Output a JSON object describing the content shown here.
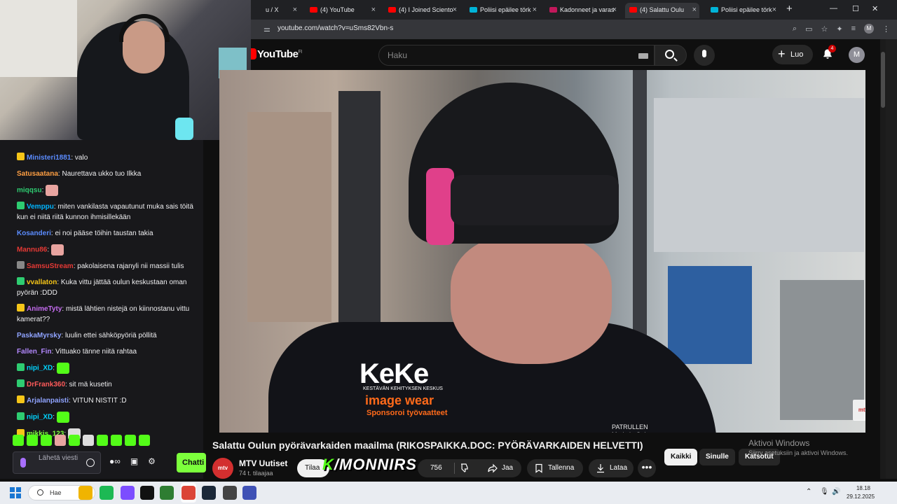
{
  "browser": {
    "tabs": [
      {
        "label": "u / X",
        "fav": "#202124",
        "active": false
      },
      {
        "label": "(4) YouTube",
        "fav": "#ff0000",
        "active": false
      },
      {
        "label": "(4) I Joined Sciento",
        "fav": "#ff0000",
        "active": false
      },
      {
        "label": "Poliisi epäilee törk",
        "fav": "#00b4d8",
        "active": false
      },
      {
        "label": "Kadonneet ja varas",
        "fav": "#c2185b",
        "active": false
      },
      {
        "label": "(4) Salattu Oulu",
        "fav": "#ff0000",
        "active": true
      },
      {
        "label": "Poliisi epäilee törk",
        "fav": "#00b4d8",
        "active": false
      }
    ],
    "new_tab": "+",
    "url": "youtube.com/watch?v=uSms82Vbn-s",
    "profile_initial": "M",
    "window_controls": {
      "minimize": "—",
      "maximize": "☐",
      "close": "✕"
    }
  },
  "youtube": {
    "logo_text": "YouTube",
    "region": "FI",
    "search_placeholder": "Haku",
    "create_label": "Luo",
    "notifications": "4",
    "avatar_initial": "M",
    "video_title": "Salattu Oulun pyörävarkaiden maailma (RIKOSPAIKKA.DOC: PYÖRÄVARKAIDEN HELVETTI)",
    "channel_name": "MTV Uutiset",
    "channel_subs": "74 t. tilaajaa",
    "channel_avatar_text": "mtv",
    "subscribe_label": "Tilaa",
    "like_count": "756",
    "share_label": "Jaa",
    "save_label": "Tallenna",
    "download_label": "Lataa",
    "more_label": "•••",
    "chips": [
      "Kaikki",
      "Sinulle",
      "Katsotut"
    ],
    "watermark": "mtv"
  },
  "video_overlay": {
    "keke": "KeKe",
    "keke_sub": "KESTÄVÄN KEHITYKSEN KESKUS",
    "image_wear": "image wear",
    "sponsor": "Sponsoroi työvaatteet",
    "patch": "PATRULLEN\nMade in Oulu"
  },
  "kick_overlay": {
    "k": "K",
    "rest": "/MONNIRS"
  },
  "windows_activate": {
    "line1": "Aktivoi Windows",
    "line2": "Siirry asetuksiin ja aktivoi Windows."
  },
  "chat": {
    "messages": [
      {
        "user": "Ministeri1881",
        "color": "#5b8cff",
        "text": ": valo",
        "badge": "#f5c518"
      },
      {
        "user": "Satusaatana",
        "color": "#ff9f43",
        "text": ": Naurettava ukko tuo Ilkka",
        "badge": ""
      },
      {
        "user": "miqqsu",
        "color": "#2ecc71",
        "text": ":",
        "badge": "",
        "emote": "#e8a4a0"
      },
      {
        "user": "Vemppu",
        "color": "#00b5ff",
        "text": ": miten vankilasta vapautunut muka sais töitä kun ei niitä riitä kunnon ihmisillekään",
        "badge": "#2ecc71"
      },
      {
        "user": "Kosanderi",
        "color": "#5b8cff",
        "text": ": ei noi pääse töihin taustan takia",
        "badge": ""
      },
      {
        "user": "Mannu86",
        "color": "#e53935",
        "text": ":",
        "badge": "",
        "emote": "#e8a4a0"
      },
      {
        "user": "SamsuStream",
        "color": "#e53935",
        "text": ": pakolaisena rajanyli nii massii tulis",
        "badge": "#888888"
      },
      {
        "user": "vvallaton",
        "color": "#f5c518",
        "text": ": Kuka vittu jättää oulun keskustaan oman pyörän :DDD",
        "badge": "#2ecc71"
      },
      {
        "user": "AnimeTyty",
        "color": "#c56cf0",
        "text": ": mistä lähtien nistejä on kiinnostanu vittu kamerat??",
        "badge": "#f5c518"
      },
      {
        "user": "PaskaMyrsky",
        "color": "#8fa3ff",
        "text": ": luulin ettei sähköpyöriä pöllitä",
        "badge": ""
      },
      {
        "user": "Fallen_Fin",
        "color": "#b388ff",
        "text": ": Vittuako tänne niitä rahtaa",
        "badge": ""
      },
      {
        "user": "nipi_XD",
        "color": "#00d4ff",
        "text": ":",
        "badge": "#2ecc71",
        "emote": "#53fc18"
      },
      {
        "user": "DrFrank360",
        "color": "#ff5a5a",
        "text": ": sit mä kusetin",
        "badge": "#2ecc71"
      },
      {
        "user": "Arjalanpaisti",
        "color": "#8fa3ff",
        "text": ": VITUN NISTIT :D",
        "badge": "#f5c518"
      },
      {
        "user": "nipi_XD",
        "color": "#00d4ff",
        "text": ":",
        "badge": "#2ecc71",
        "emote": "#53fc18"
      },
      {
        "user": "mikkis_123",
        "color": "#7cff3c",
        "text": ":",
        "badge": "#f5c518",
        "emote": "#dddddd"
      }
    ],
    "emote_bar": [
      "#53fc18",
      "#53fc18",
      "#53fc18",
      "#e8a4a0",
      "#53fc18",
      "#dddddd",
      "#53fc18",
      "#53fc18",
      "#53fc18",
      "#53fc18"
    ],
    "input_placeholder": "Lähetä viesti",
    "send_label": "Chatti"
  },
  "taskbar": {
    "search_label": "Hae",
    "time": "18.18",
    "date": "29.12.2025",
    "apps": [
      "#f0b400",
      "#1db954",
      "#7c4dff",
      "#111111",
      "#2e7d32",
      "#db4437",
      "#1b2838",
      "#444444",
      "#3f51b5"
    ]
  }
}
